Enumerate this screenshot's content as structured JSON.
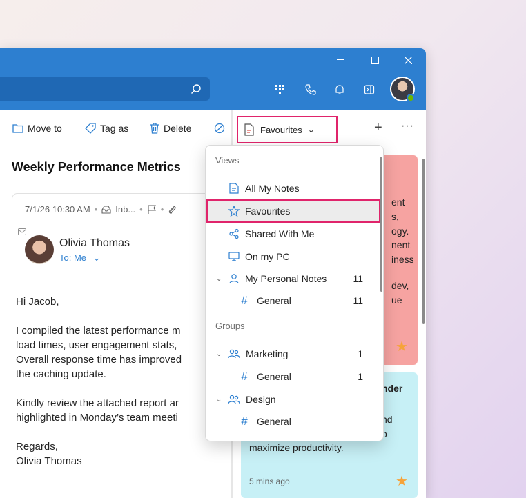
{
  "colors": {
    "titlebar": "#2d7fd0",
    "accent": "#2d7fd0",
    "highlight": "#e0246b",
    "note_red": "#f6a3a1",
    "note_cyan": "#c7f0f6",
    "star": "#f6a33a"
  },
  "toolbar": {
    "move_to": "Move to",
    "tag_as": "Tag as",
    "delete": "Delete"
  },
  "email": {
    "subject": "Weekly Performance Metrics",
    "date": "7/1/26 10:30 AM",
    "folder": "Inb...",
    "sender": "Olivia Thomas",
    "to": "To: Me",
    "body": "Hi Jacob,\n\nI compiled the latest performance m\nload times, user engagement stats,\nOverall response time has improved\nthe caching update.\n\nKindly review the attached report ar\nhighlighted in Monday’s team meeti\n\nRegards,\nOlivia Thomas"
  },
  "notes": {
    "dropdown_label": "Favourites",
    "red_note_lines": [
      "ent",
      "s,",
      "ogy.",
      "nent",
      "iness",
      "dev,",
      "ue"
    ],
    "cyan_note_lines": [
      "nder",
      "nd",
      "o",
      "maximize productivity."
    ],
    "cyan_time": "5 mins ago"
  },
  "menu": {
    "views_header": "Views",
    "groups_header": "Groups",
    "items": [
      {
        "label": "All My Notes",
        "count": ""
      },
      {
        "label": "Favourites",
        "count": ""
      },
      {
        "label": "Shared With Me",
        "count": ""
      },
      {
        "label": "On my PC",
        "count": ""
      },
      {
        "label": "My Personal Notes",
        "count": "11"
      },
      {
        "label": "General",
        "count": "11"
      },
      {
        "label": "Marketing",
        "count": "1"
      },
      {
        "label": "General",
        "count": "1"
      },
      {
        "label": "Design",
        "count": ""
      },
      {
        "label": "General",
        "count": ""
      }
    ]
  }
}
